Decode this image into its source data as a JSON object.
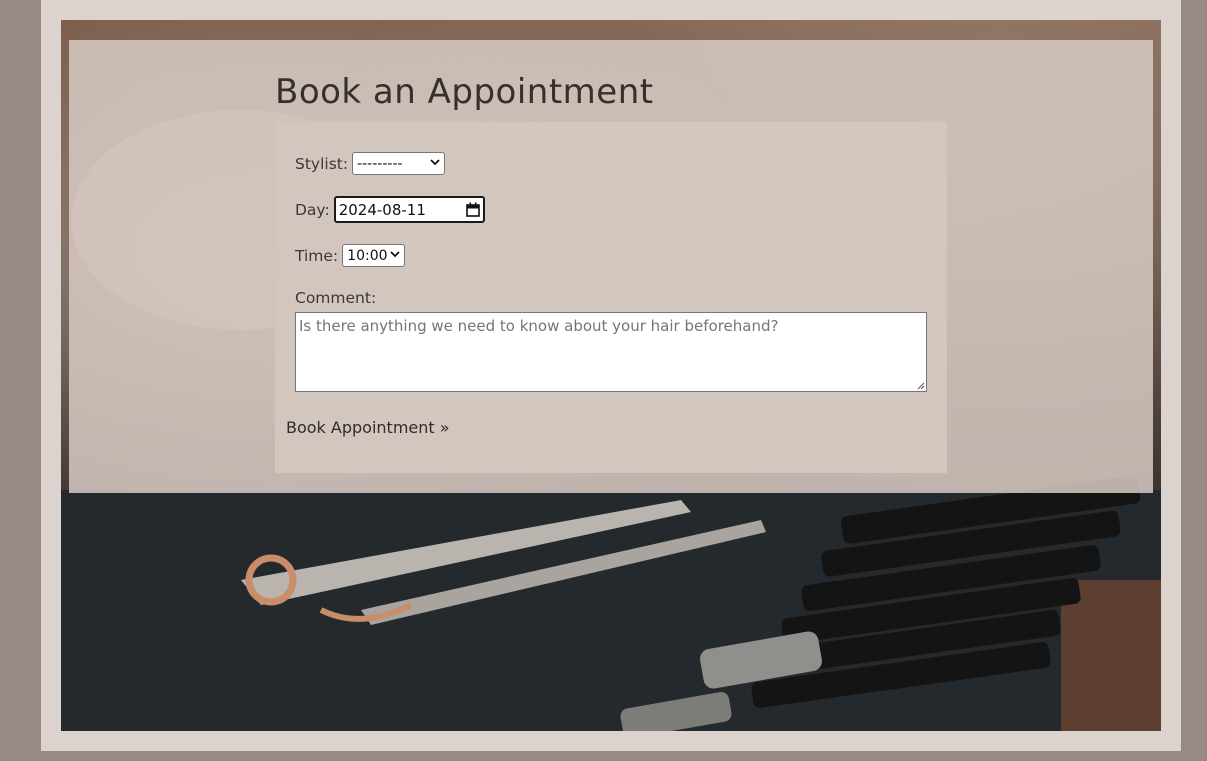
{
  "page": {
    "title": "Book an Appointment"
  },
  "form": {
    "stylist_label": "Stylist:",
    "stylist_value": "---------",
    "day_label": "Day:",
    "day_value": "2024-08-11",
    "time_label": "Time:",
    "time_value": "10:00",
    "comment_label": "Comment:",
    "comment_placeholder": "Is there anything we need to know about your hair beforehand?",
    "submit_label": "Book Appointment »"
  },
  "icons": {
    "select_chevron": "chevron-down-icon",
    "date_picker": "calendar-icon",
    "textarea_resize": "resize-grip-icon"
  },
  "colors": {
    "page_background": "#978a84",
    "frame": "#dcd3ce",
    "overlay": "#d6cac3",
    "form_card": "#d3c6bf",
    "text": "#33302e"
  }
}
